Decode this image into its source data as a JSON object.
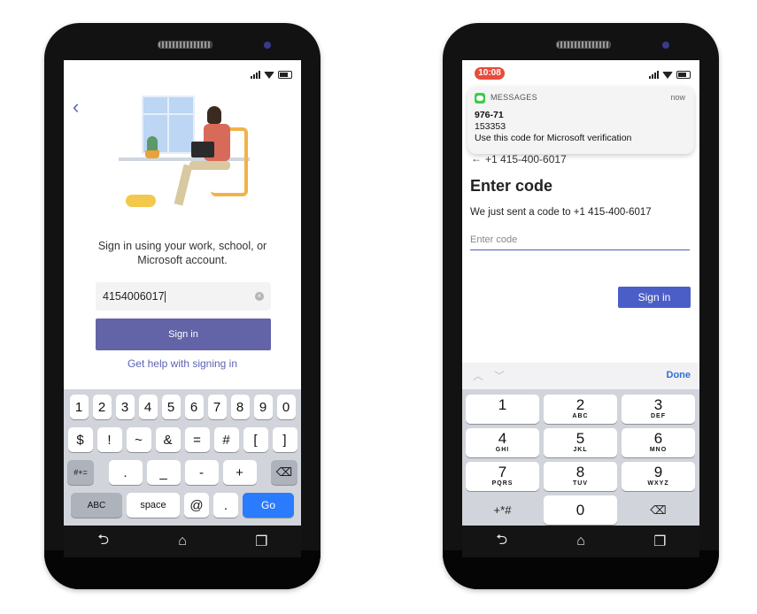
{
  "left_screen": {
    "back_icon": "chevron-left",
    "signin_text_line1": "Sign in using your work, school, or",
    "signin_text_line2": "Microsoft account.",
    "phone_value": "4154006017",
    "signin_button": "Sign in",
    "help_link": "Get help with signing in",
    "keyboard": {
      "row1": [
        "1",
        "2",
        "3",
        "4",
        "5",
        "6",
        "7",
        "8",
        "9",
        "0"
      ],
      "row2": [
        "$",
        "!",
        "~",
        "&",
        "=",
        "#",
        "[",
        "]"
      ],
      "row3_left": "#+=",
      "row3": [
        ".",
        "_",
        "-",
        "+"
      ],
      "row4": [
        "ABC",
        "space",
        "@",
        ".",
        "Go"
      ]
    }
  },
  "right_screen": {
    "status_time": "10:08",
    "notification": {
      "app": "MESSAGES",
      "time": "now",
      "line1": "976-71",
      "line2": "153353",
      "line3": "Use this code for Microsoft verification"
    },
    "back_number": "+1 415-400-6017",
    "title": "Enter code",
    "sent_text": "We just sent a code to +1 415-400-6017",
    "code_placeholder": "Enter code",
    "signin_button": "Sign in",
    "keyboard_done": "Done",
    "numpad": [
      {
        "n": "1",
        "l": ""
      },
      {
        "n": "2",
        "l": "ABC"
      },
      {
        "n": "3",
        "l": "DEF"
      },
      {
        "n": "4",
        "l": "GHI"
      },
      {
        "n": "5",
        "l": "JKL"
      },
      {
        "n": "6",
        "l": "MNO"
      },
      {
        "n": "7",
        "l": "PQRS"
      },
      {
        "n": "8",
        "l": "TUV"
      },
      {
        "n": "9",
        "l": "WXYZ"
      },
      {
        "n": "+*#",
        "l": ""
      },
      {
        "n": "0",
        "l": ""
      },
      {
        "n": "⌫",
        "l": ""
      }
    ]
  }
}
